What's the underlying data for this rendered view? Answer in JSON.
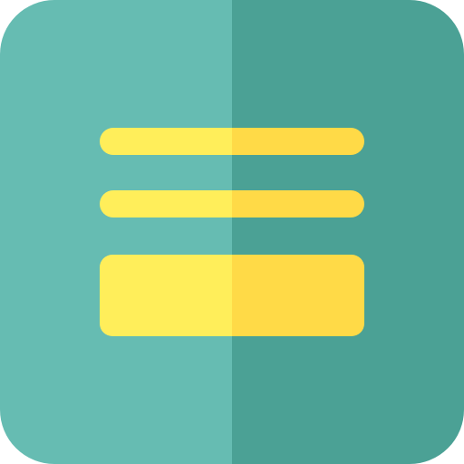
{
  "icon": {
    "semantic_name": "menu-card-icon",
    "colors": {
      "tile_left": "#66BCB2",
      "tile_right": "#4BA195",
      "bar_left": "#FFEE5A",
      "bar_right": "#FFDA47"
    }
  }
}
